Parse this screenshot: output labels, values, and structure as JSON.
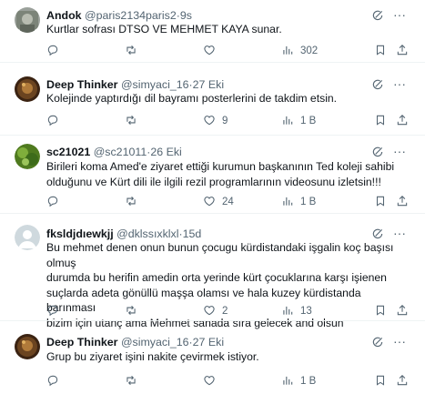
{
  "tweets": [
    {
      "name": "Andok",
      "handle": "@paris2134paris2",
      "sep": "·",
      "time": "9s",
      "text": "Kurtlar sofrası DTSO VE MEHMET KAYA sunar.",
      "avatar_color": "#8a8f86",
      "replies": "",
      "retweets": "",
      "likes": "",
      "views": "302"
    },
    {
      "name": "Deep Thinker",
      "handle": "@simyaci_16",
      "sep": "·",
      "time": "27 Eki",
      "text": "Kolejinde yaptırdığı dil bayramı posterlerini de takdim etsin.",
      "avatar_color": "#5a3a1e",
      "replies": "",
      "retweets": "",
      "likes": "9",
      "views": "1 B"
    },
    {
      "name": "sc21021",
      "handle": "@sc21011",
      "sep": "·",
      "time": "26 Eki",
      "text": "Birileri koma Amed'e ziyaret ettiği kurumun başkanının Ted koleji sahibi\nolduğunu ve Kürt dili ile ilgili rezil programlarının videosunu izletsin!!!",
      "avatar_color": "#6b8e23",
      "replies": "",
      "retweets": "",
      "likes": "24",
      "views": "1 B"
    },
    {
      "name": "fksldjdıewkjj",
      "handle": "@dklssıxklxl",
      "sep": "·",
      "time": "15d",
      "text": "Bu mehmet denen onun bunun çocugu kürdistandaki işgalin koç başısı olmuş\ndurumda bu herifin amedin orta yerinde kürt çocuklarına karşı işienen\nsuçlarda adeta gönüllü maşşa olamsı ve hala kuzey kürdistanda barınması\nbizim için utanç ama Mehmet sanada sıra gelecek and olsun",
      "avatar_color": "#cfd9de",
      "replies": "",
      "retweets": "",
      "likes": "2",
      "views": "13"
    },
    {
      "name": "Deep Thinker",
      "handle": "@simyaci_16",
      "sep": "·",
      "time": "27 Eki",
      "text": "Grup bu ziyaret işini nakite çevirmek istiyor.",
      "avatar_color": "#5a3a1e",
      "replies": "",
      "retweets": "",
      "likes": "",
      "views": "1 B"
    }
  ],
  "icons": {
    "reply": "reply-icon",
    "retweet": "retweet-icon",
    "like": "like-icon",
    "views": "views-icon",
    "bookmark": "bookmark-icon",
    "share": "share-icon",
    "grok": "grok-icon",
    "more": "more-icon"
  }
}
